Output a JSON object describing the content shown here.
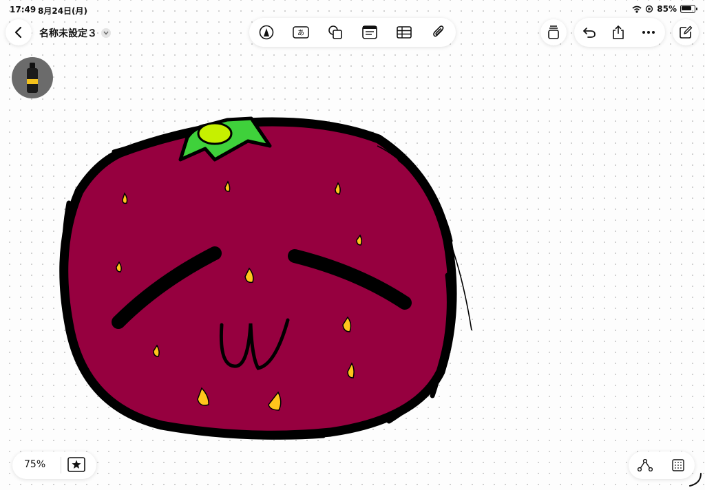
{
  "status": {
    "time": "17:49",
    "date": "8月24日(月)",
    "battery": "85%"
  },
  "document": {
    "title": "名称未設定３"
  },
  "toolbar": {
    "tools": [
      "pen-tool-icon",
      "text-tool-icon",
      "shapes-icon",
      "note-icon",
      "table-icon",
      "attachment-icon"
    ],
    "right": [
      "layers-icon",
      "undo-icon",
      "share-icon",
      "more-icon",
      "new-board-icon"
    ]
  },
  "bottom": {
    "zoom": "75%"
  },
  "canvas": {
    "fill_color": "#96003f",
    "leaf_color": "#3fd13b",
    "highlight_color": "#c6f000",
    "seed_color": "#ffc51c",
    "stroke_color": "#000000"
  }
}
